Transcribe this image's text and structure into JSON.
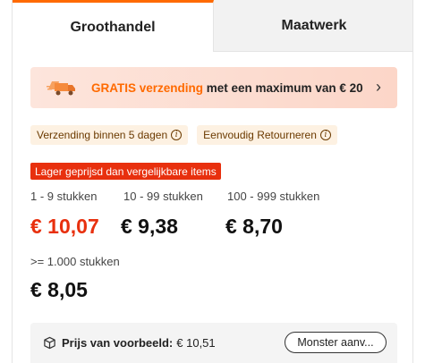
{
  "tabs": [
    {
      "label": "Groothandel",
      "active": true
    },
    {
      "label": "Maatwerk",
      "active": false
    }
  ],
  "promo": {
    "highlight": "GRATIS verzending",
    "text": " met een maximum van € 20",
    "icon": "truck-icon",
    "arrow": "›",
    "accent_color": "#ff6a00"
  },
  "tags": [
    {
      "label": "Verzending binnen 5 dagen"
    },
    {
      "label": "Eenvoudig Retourneren"
    }
  ],
  "info_glyph": "i",
  "cheaper_badge": "Lager geprijsd dan vergelijkbare items",
  "price_tiers": [
    {
      "range": "1 - 9 stukken",
      "price": "€ 10,07"
    },
    {
      "range": "10 - 99 stukken",
      "price": "€ 9,38"
    },
    {
      "range": "100 - 999 stukken",
      "price": "€ 8,70"
    },
    {
      "range": ">= 1.000 stukken",
      "price": "€ 8,05"
    }
  ],
  "sample": {
    "label": "Prijs van voorbeeld:",
    "value": "€ 10,51",
    "button": "Monster aanv..."
  },
  "colors": {
    "accent": "#ff6a00",
    "price_red": "#e8300e",
    "tag_bg": "#fdf1e2"
  }
}
